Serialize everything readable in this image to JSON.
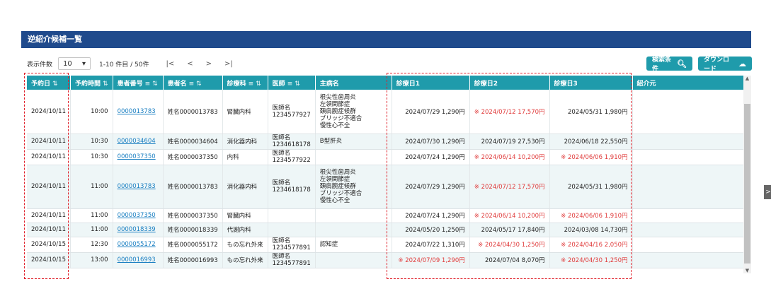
{
  "header": {
    "title": "逆紹介候補一覧"
  },
  "toolbar": {
    "display_count_label": "表示件数",
    "display_count_value": "10",
    "range_text": "1-10 件目 / 50件",
    "first": "|<",
    "prev": "<",
    "next": ">",
    "last": ">|",
    "search_label": "検索条件",
    "download_label": "ダウンロード"
  },
  "table": {
    "columns": [
      "予約日",
      "予約時間",
      "患者番号",
      "患者名",
      "診療科",
      "医師",
      "主病名",
      "診療日1",
      "診療日2",
      "診療日3",
      "紹介元"
    ],
    "rows": [
      {
        "date": "2024/10/11",
        "time": "10:00",
        "pid": "0000013783",
        "name": "姓名0000013783",
        "dept": "腎臓内科",
        "doc": [
          "医師名",
          "1234577927"
        ],
        "disease": [
          "根尖性歯周炎",
          "左領関節症",
          "頚肩腕症候群",
          "ブリッジ不適合",
          "慢性心不全"
        ],
        "d1": "2024/07/29 1,290円",
        "d2": "※ 2024/07/12 17,570円",
        "d3": "2024/05/31 1,980円",
        "r1": false,
        "r2": true,
        "r3": false
      },
      {
        "date": "2024/10/11",
        "time": "10:30",
        "pid": "0000034604",
        "name": "姓名0000034604",
        "dept": "消化器内科",
        "doc": [
          "医師名",
          "1234618178"
        ],
        "disease": [
          "B型肝炎"
        ],
        "d1": "2024/07/30 1,290円",
        "d2": "2024/07/19 27,530円",
        "d3": "2024/06/18 22,550円",
        "r1": false,
        "r2": false,
        "r3": false
      },
      {
        "date": "2024/10/11",
        "time": "10:30",
        "pid": "0000037350",
        "name": "姓名0000037350",
        "dept": "内科",
        "doc": [
          "医師名",
          "1234577922"
        ],
        "disease": [],
        "d1": "2024/07/24 1,290円",
        "d2": "※ 2024/06/14 10,200円",
        "d3": "※ 2024/06/06 1,910円",
        "r1": false,
        "r2": true,
        "r3": true
      },
      {
        "date": "2024/10/11",
        "time": "11:00",
        "pid": "0000013783",
        "name": "姓名0000013783",
        "dept": "消化器内科",
        "doc": [
          "医師名",
          "1234618178"
        ],
        "disease": [
          "根尖性歯周炎",
          "左領関節症",
          "頚肩腕症候群",
          "ブリッジ不適合",
          "慢性心不全"
        ],
        "d1": "2024/07/29 1,290円",
        "d2": "※ 2024/07/12 17,570円",
        "d3": "2024/05/31 1,980円",
        "r1": false,
        "r2": true,
        "r3": false
      },
      {
        "date": "2024/10/11",
        "time": "11:00",
        "pid": "0000037350",
        "name": "姓名0000037350",
        "dept": "腎臓内科",
        "doc": [],
        "disease": [],
        "d1": "2024/07/24 1,290円",
        "d2": "※ 2024/06/14 10,200円",
        "d3": "※ 2024/06/06 1,910円",
        "r1": false,
        "r2": true,
        "r3": true
      },
      {
        "date": "2024/10/11",
        "time": "11:00",
        "pid": "0000018339",
        "name": "姓名0000018339",
        "dept": "代謝内科",
        "doc": [],
        "disease": [],
        "d1": "2024/05/20 1,250円",
        "d2": "2024/05/17 17,840円",
        "d3": "2024/03/08 14,730円",
        "r1": false,
        "r2": false,
        "r3": false
      },
      {
        "date": "2024/10/15",
        "time": "12:30",
        "pid": "0000055172",
        "name": "姓名0000055172",
        "dept": "もの忘れ外来",
        "doc": [
          "医師名",
          "1234577891"
        ],
        "disease": [
          "認知症"
        ],
        "d1": "2024/07/22 1,310円",
        "d2": "※ 2024/04/30 1,250円",
        "d3": "※ 2024/04/16 2,050円",
        "r1": false,
        "r2": true,
        "r3": true
      },
      {
        "date": "2024/10/15",
        "time": "13:00",
        "pid": "0000016993",
        "name": "姓名0000016993",
        "dept": "もの忘れ外来",
        "doc": [
          "医師名",
          "1234577891"
        ],
        "disease": [],
        "d1": "※ 2024/07/09 1,290円",
        "d2": "2024/07/04 8,070円",
        "d3": "※ 2024/04/30 1,250円",
        "r1": true,
        "r2": false,
        "r3": true
      }
    ]
  },
  "colors": {
    "header_bg": "#1f4a8c",
    "accent": "#1f9bab",
    "warn": "#e03a3a",
    "link": "#1a7fc2"
  }
}
